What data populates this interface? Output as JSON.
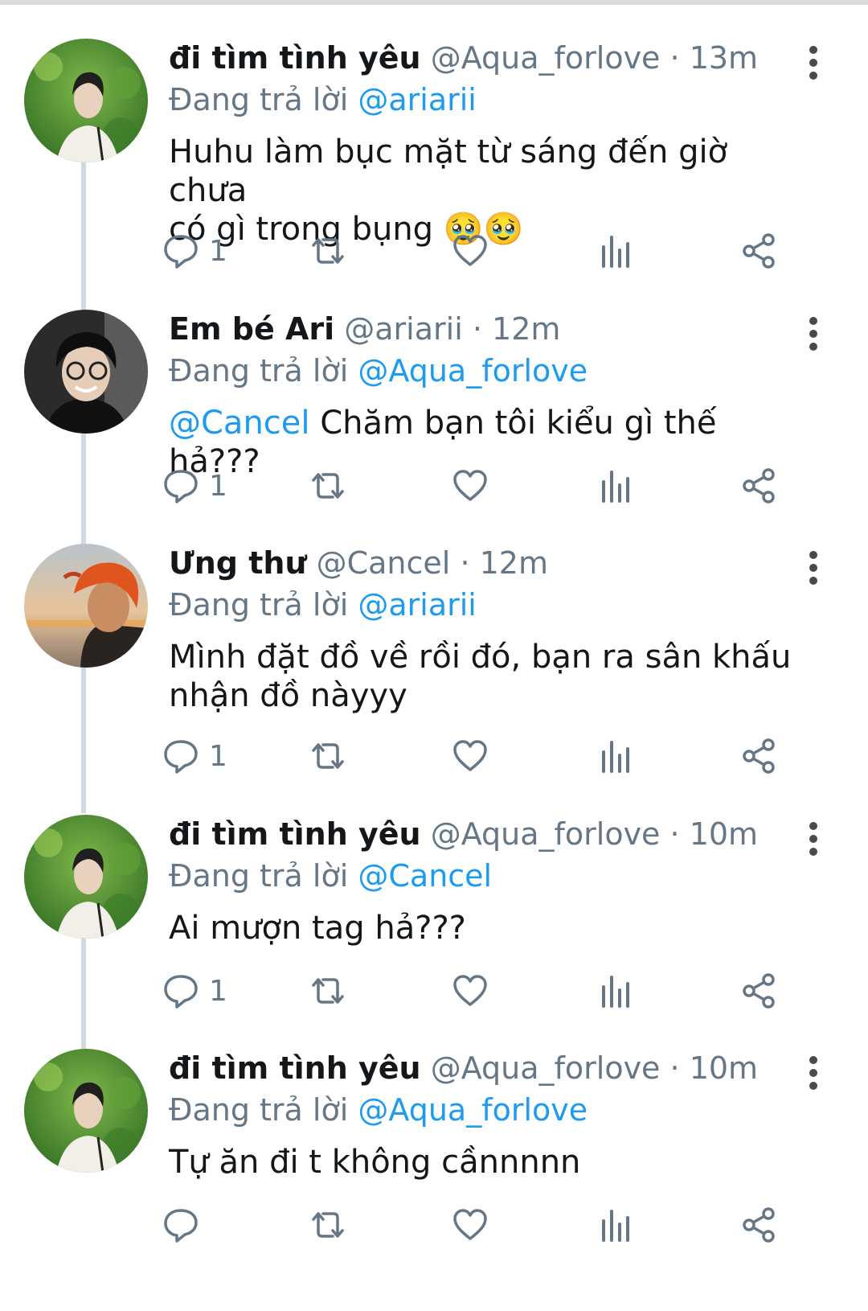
{
  "tweets": [
    {
      "name": "đi tìm tình yêu",
      "handle": "@Aqua_forlove",
      "time": "13m",
      "reply_prefix": "Đang trả lời",
      "reply_to": "@ariarii",
      "mention": "",
      "text_lines": [
        "Huhu làm bục mặt từ sáng đến giờ chưa",
        "có gì trong bụng 🥹🥹"
      ],
      "reply_count": "1",
      "avatar": "green-leaves-portrait"
    },
    {
      "name": "Em bé Ari",
      "handle": "@ariarii",
      "time": "12m",
      "reply_prefix": "Đang trả lời",
      "reply_to": "@Aqua_forlove",
      "mention": "@Cancel",
      "text_lines": [
        "Chăm bạn tôi kiểu gì thế hả???"
      ],
      "reply_count": "1",
      "avatar": "dark-glasses-portrait"
    },
    {
      "name": "Ưng thư",
      "handle": "@Cancel",
      "time": "12m",
      "reply_prefix": "Đang trả lời",
      "reply_to": "@ariarii",
      "mention": "",
      "text_lines": [
        "Mình đặt đồ về rồi đó, bạn ra sân khấu",
        "nhận đồ nàyyy"
      ],
      "reply_count": "1",
      "avatar": "sunset-portrait"
    },
    {
      "name": "đi tìm tình yêu",
      "handle": "@Aqua_forlove",
      "time": "10m",
      "reply_prefix": "Đang trả lời",
      "reply_to": "@Cancel",
      "mention": "",
      "text_lines": [
        "Ai mượn tag hả???"
      ],
      "reply_count": "1",
      "avatar": "green-leaves-portrait"
    },
    {
      "name": "đi tìm tình yêu",
      "handle": "@Aqua_forlove",
      "time": "10m",
      "reply_prefix": "Đang trả lời",
      "reply_to": "@Aqua_forlove",
      "mention": "",
      "text_lines": [
        "Tự ăn đi t không cầnnnnn"
      ],
      "reply_count": "",
      "avatar": "green-leaves-portrait"
    }
  ],
  "colors": {
    "link": "#1d9bf0",
    "muted": "#657786",
    "text": "#14171a"
  },
  "icons": [
    "reply-icon",
    "retweet-icon",
    "like-icon",
    "stats-icon",
    "share-icon",
    "more-icon"
  ]
}
